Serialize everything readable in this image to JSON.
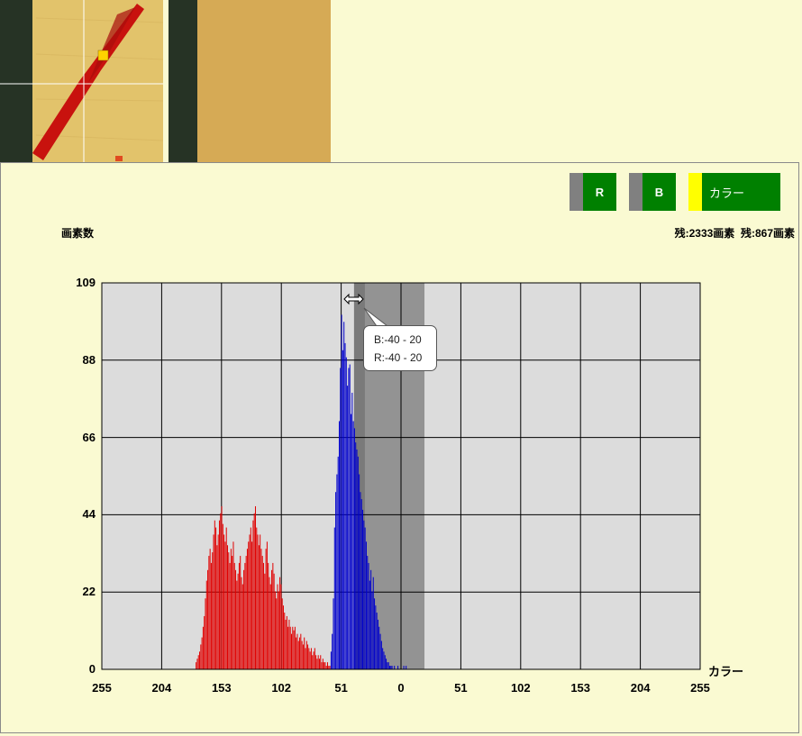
{
  "thumbnails": {
    "crosshair_left": {
      "background": "#e7c46a",
      "stroke": "#c01010"
    },
    "cropped_right": {
      "background": "#d6aa55"
    }
  },
  "toggles": {
    "r": {
      "label": "R",
      "swatch": "#808080"
    },
    "b": {
      "label": "B",
      "swatch": "#808080"
    },
    "color": {
      "label": "カラー",
      "swatch": "#ffff00"
    }
  },
  "y_axis_label": "画素数",
  "counts_text": "残:2333画素  残:867画素",
  "x_axis_label": "カラー",
  "y_ticks": [
    "109",
    "88",
    "66",
    "44",
    "22",
    "0"
  ],
  "x_ticks": [
    "255",
    "204",
    "153",
    "102",
    "51",
    "0",
    "51",
    "102",
    "153",
    "204",
    "255"
  ],
  "tooltip": {
    "line1": "B:-40 - 20",
    "line2": "R:-40 - 20"
  },
  "range_handle_icon": "horizontal-resize-icon",
  "chart_data": {
    "type": "bar",
    "x_range": [
      -255,
      255
    ],
    "ylim": [
      0,
      109
    ],
    "grid": true,
    "selected_range": [
      -40,
      20
    ],
    "series": [
      {
        "color": "#e00000",
        "x_start": -175,
        "x_end": -60,
        "values": [
          2,
          3,
          4,
          5,
          7,
          9,
          12,
          15,
          20,
          25,
          28,
          32,
          34,
          30,
          33,
          38,
          42,
          40,
          35,
          38,
          42,
          44,
          46,
          41,
          38,
          36,
          40,
          35,
          33,
          30,
          34,
          32,
          36,
          30,
          28,
          25,
          27,
          30,
          32,
          26,
          24,
          28,
          30,
          32,
          34,
          36,
          38,
          40,
          36,
          42,
          44,
          46,
          40,
          38,
          35,
          38,
          34,
          32,
          30,
          27,
          34,
          36,
          30,
          26,
          24,
          28,
          30,
          27,
          22,
          20,
          24,
          22,
          26,
          24,
          20,
          18,
          16,
          14,
          15,
          12,
          14,
          12,
          10,
          12,
          11,
          12,
          9,
          10,
          8,
          9,
          10,
          8,
          7,
          9,
          6,
          8,
          7,
          6,
          5,
          6,
          4,
          5,
          6,
          4,
          3,
          4,
          3,
          4,
          2,
          3,
          2,
          2,
          1,
          2,
          1,
          1
        ]
      },
      {
        "color": "#0000cc",
        "x_start": -60,
        "x_end": 5,
        "values": [
          5,
          10,
          20,
          40,
          50,
          55,
          60,
          70,
          85,
          100,
          90,
          98,
          92,
          88,
          80,
          85,
          86,
          72,
          78,
          70,
          68,
          64,
          62,
          60,
          55,
          50,
          48,
          45,
          42,
          40,
          36,
          32,
          30,
          25,
          28,
          22,
          26,
          20,
          18,
          16,
          14,
          12,
          10,
          8,
          6,
          5,
          4,
          3,
          2,
          2,
          1,
          1,
          1,
          0,
          1,
          0,
          0,
          1,
          0,
          0,
          0,
          0,
          1,
          0,
          1
        ]
      }
    ]
  }
}
